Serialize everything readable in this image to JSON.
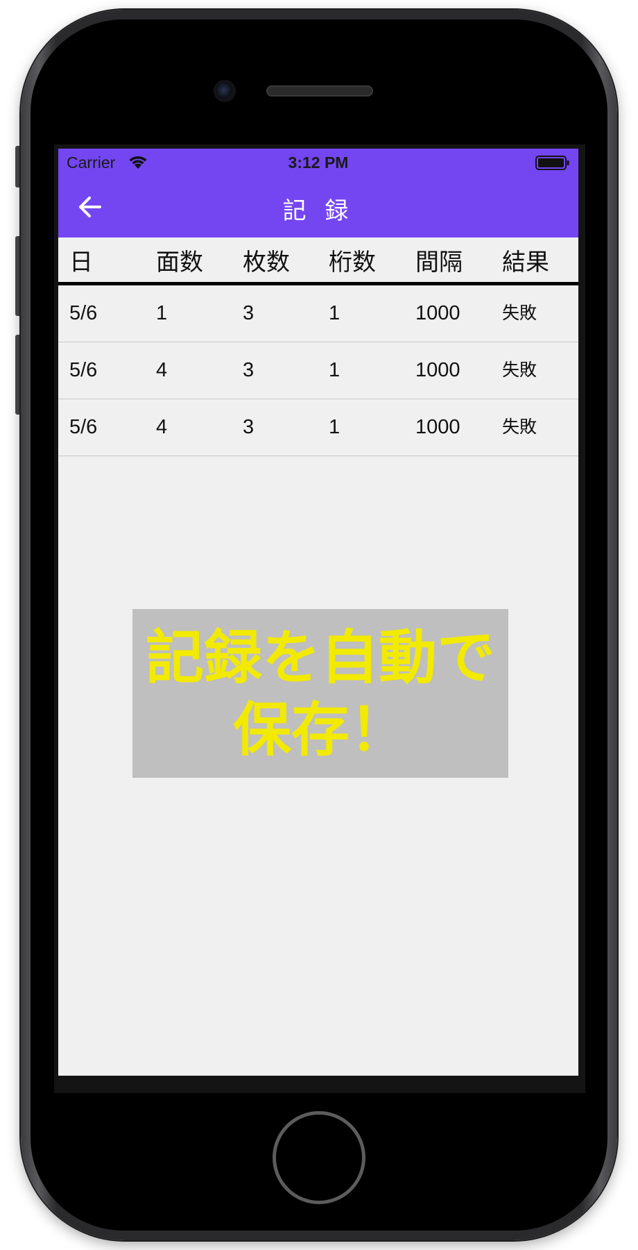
{
  "status_bar": {
    "carrier": "Carrier",
    "time": "3:12 PM",
    "wifi_icon": "wifi-icon",
    "battery_icon": "battery-full-icon"
  },
  "nav": {
    "title": "記 録",
    "back_icon": "arrow-left-icon",
    "color": "#7446f2"
  },
  "table": {
    "headers": [
      "日",
      "面数",
      "枚数",
      "桁数",
      "間隔",
      "結果"
    ],
    "rows": [
      [
        "5/6",
        "1",
        "3",
        "1",
        "1000",
        "失敗"
      ],
      [
        "5/6",
        "4",
        "3",
        "1",
        "1000",
        "失敗"
      ],
      [
        "5/6",
        "4",
        "3",
        "1",
        "1000",
        "失敗"
      ]
    ]
  },
  "promo": {
    "text": "記録を自動で\n保存！",
    "text_color": "#f2ea00",
    "background": "#bfbfbf"
  }
}
